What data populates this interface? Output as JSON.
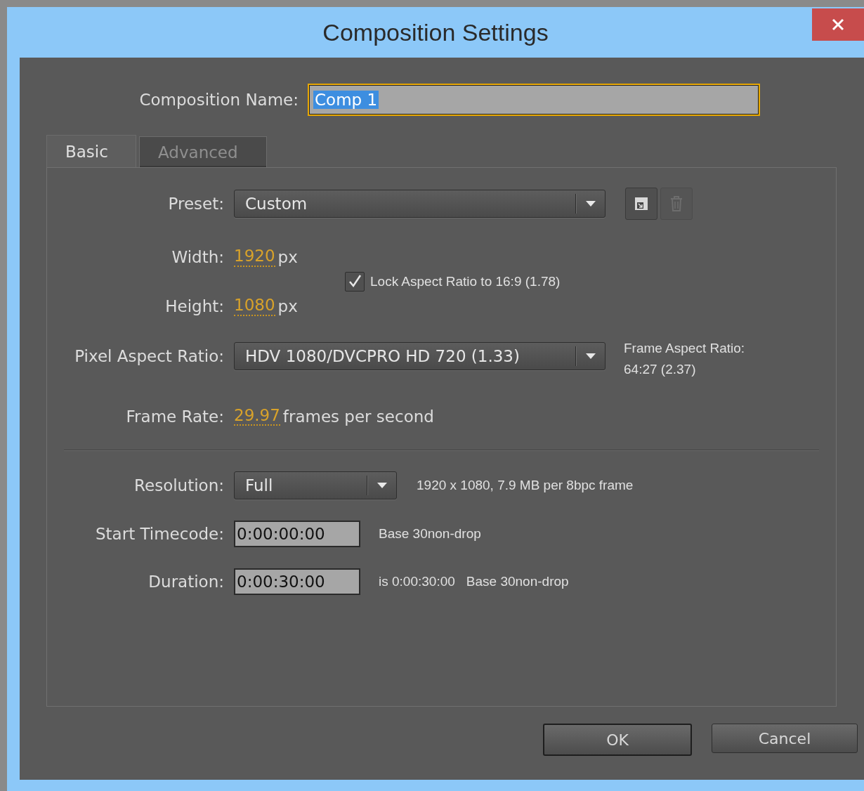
{
  "window": {
    "title": "Composition Settings"
  },
  "composition_name": {
    "label": "Composition Name:",
    "value": "Comp 1",
    "text_selected": true
  },
  "tabs": [
    {
      "label": "Basic",
      "selected": true
    },
    {
      "label": "Advanced",
      "selected": false
    }
  ],
  "preset": {
    "label": "Preset:",
    "value": "Custom"
  },
  "preset_actions": [
    {
      "kind": "save",
      "disabled": false
    },
    {
      "kind": "delete",
      "disabled": true
    }
  ],
  "width": {
    "label": "Width:",
    "value": "1920",
    "unit": "px"
  },
  "height": {
    "label": "Height:",
    "value": "1080",
    "unit": "px"
  },
  "lock_aspect_ratio": {
    "label": "Lock Aspect Ratio to 16:9 (1.78)",
    "checked": true
  },
  "pixel_aspect_ratio": {
    "label": "Pixel Aspect Ratio:",
    "value": "HDV 1080/DVCPRO HD 720 (1.33)"
  },
  "frame_aspect_ratio": {
    "label": "Frame Aspect Ratio:",
    "value": "64:27 (2.37)"
  },
  "frame_rate": {
    "label": "Frame Rate:",
    "value": "29.97",
    "unit": "frames per second"
  },
  "resolution": {
    "label": "Resolution:",
    "value": "Full",
    "info": "1920 x 1080, 7.9 MB per 8bpc frame"
  },
  "start_timecode": {
    "label": "Start Timecode:",
    "value": "0:00:00:00",
    "info": "Base 30non-drop"
  },
  "duration": {
    "label": "Duration:",
    "value": "0:00:30:00",
    "info": "is 0:00:30:00",
    "base": "Base 30non-drop"
  },
  "buttons": [
    {
      "label": "OK",
      "default": true
    },
    {
      "label": "Cancel",
      "default": false
    }
  ]
}
